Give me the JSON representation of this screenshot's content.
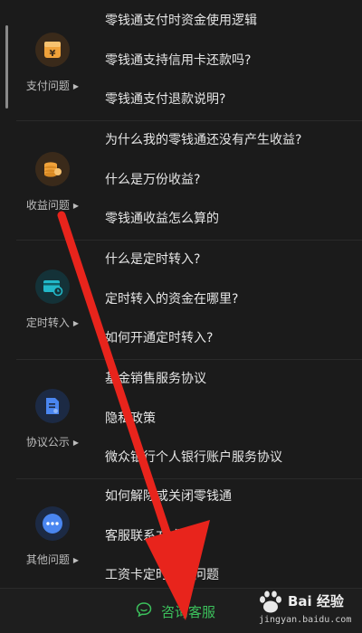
{
  "sections": [
    {
      "category": "支付问题",
      "icon": "yuan-box-icon",
      "items": [
        "零钱通支付时资金使用逻辑",
        "零钱通支持信用卡还款吗?",
        "零钱通支付退款说明?"
      ]
    },
    {
      "category": "收益问题",
      "icon": "coin-stack-icon",
      "items": [
        "为什么我的零钱通还没有产生收益?",
        "什么是万份收益?",
        "零钱通收益怎么算的"
      ]
    },
    {
      "category": "定时转入",
      "icon": "card-clock-icon",
      "items": [
        "什么是定时转入?",
        "定时转入的资金在哪里?",
        "如何开通定时转入?"
      ]
    },
    {
      "category": "协议公示",
      "icon": "document-icon",
      "items": [
        "基金销售服务协议",
        "隐私政策",
        "微众银行个人银行账户服务协议"
      ]
    },
    {
      "category": "其他问题",
      "icon": "more-dots-icon",
      "items": [
        "如何解除或关闭零钱通",
        "客服联系方式",
        "工资卡定时转入问题"
      ]
    }
  ],
  "bottom": {
    "consult_label": "咨询客服",
    "icon": "chat-bubble-icon"
  },
  "watermark": {
    "text": "Bai 经验",
    "url": "jingyan.baidu.com"
  },
  "colors": {
    "background": "#1b1b1b",
    "accent_green": "#3cc15c",
    "icon_orange": "#f0a23a",
    "icon_teal": "#22b8c8",
    "icon_blue": "#4a86f0",
    "annotation_red": "#e8241c"
  }
}
